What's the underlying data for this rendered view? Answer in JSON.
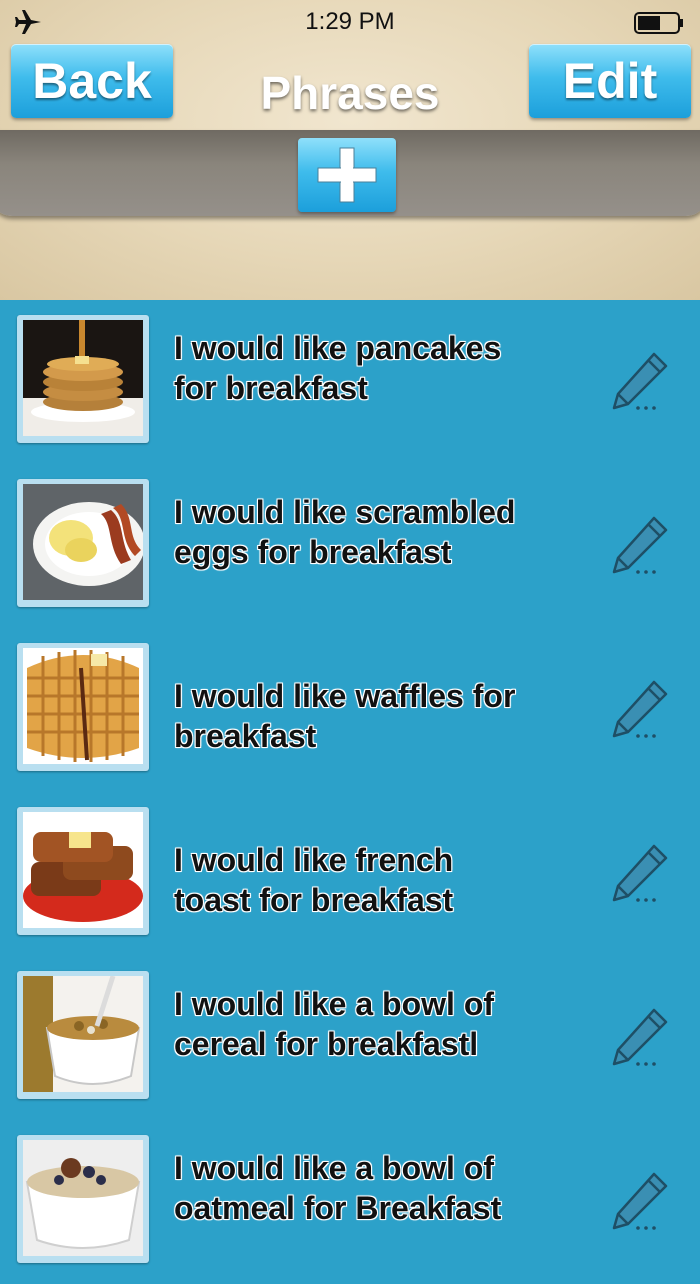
{
  "status": {
    "time": "1:29 PM"
  },
  "nav": {
    "back_label": "Back",
    "title": "Phrases",
    "edit_label": "Edit"
  },
  "toolbar": {
    "add_icon": "plus-icon"
  },
  "phrases": [
    {
      "text": "I would like pancakes for breakfast",
      "image": "pancakes"
    },
    {
      "text": "I would like scrambled eggs for breakfast",
      "image": "scrambled-eggs"
    },
    {
      "text": "I would like waffles for breakfast",
      "image": "waffles"
    },
    {
      "text": "I would like french toast for breakfast",
      "image": "french-toast"
    },
    {
      "text": "I would like a bowl of cereal for breakfastl",
      "image": "cereal"
    },
    {
      "text": "I would like a bowl of oatmeal for Breakfast",
      "image": "oatmeal"
    }
  ],
  "colors": {
    "list_bg": "#2ca1c9",
    "button_blue": "#3fbcec",
    "toolbar": "#8a857c"
  }
}
